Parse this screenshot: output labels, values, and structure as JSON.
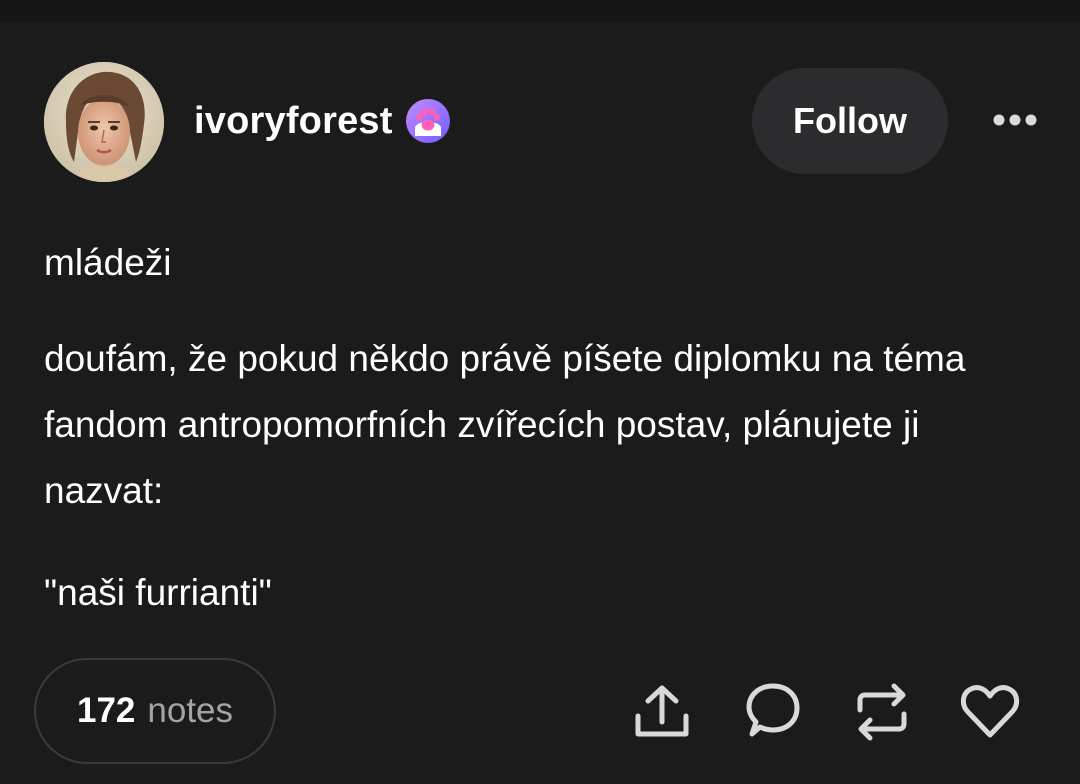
{
  "post": {
    "username": "ivoryforest",
    "follow_label": "Follow",
    "paragraphs": [
      "mládeži",
      "doufám, že pokud někdo právě píšete diplomku na téma fandom antropomorfních zvířecích postav, plánujete ji nazvat:",
      "\"naši furrianti\""
    ]
  },
  "footer": {
    "notes_count": "172",
    "notes_label": "notes"
  },
  "icons": {
    "badge": "paw-badge-icon",
    "more": "more-dots-icon",
    "share": "share-icon",
    "reply": "reply-bubble-icon",
    "reblog": "reblog-icon",
    "like": "heart-icon"
  },
  "colors": {
    "background": "#1b1b1c",
    "button_bg": "#2c2c2e",
    "badge_gradient_start": "#b77bff",
    "badge_gradient_end": "#7b5cff",
    "paw": "#ff5fb5",
    "muted_text": "#a4a4a8"
  }
}
